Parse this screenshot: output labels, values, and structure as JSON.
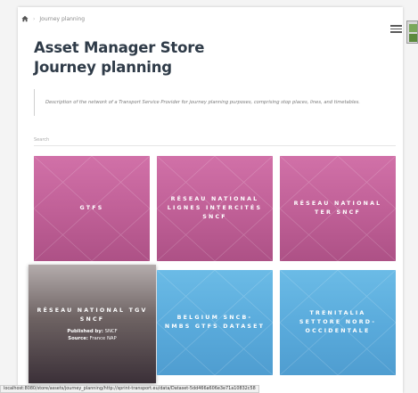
{
  "breadcrumb": {
    "current": "Journey planning",
    "separator": "›"
  },
  "header": {
    "title_line1": "Asset Manager Store",
    "title_line2": "Journey planning"
  },
  "description": "Description of the network of a Transport Service Provider for journey planning purposes, comprising stop places, lines, and timetables.",
  "search": {
    "placeholder": "Search",
    "value": ""
  },
  "tiles": [
    {
      "label": "GTFS",
      "color": "pink"
    },
    {
      "label": "RÉSEAU NATIONAL LIGNES INTERCITÉS SNCF",
      "color": "pink"
    },
    {
      "label": "RÉSEAU NATIONAL TER SNCF",
      "color": "pink"
    },
    {
      "label": "RÉSEAU NATIONAL TGV SNCF",
      "color": "dark",
      "published_by_label": "Published by:",
      "published_by": "SNCF",
      "source_label": "Source:",
      "source": "France NAP"
    },
    {
      "label": "BELGIUM SNCB-NMBS GTFS DATASET",
      "color": "blue"
    },
    {
      "label": "TRENITALIA SETTORE NORD-OCCIDENTALE",
      "color": "blue"
    }
  ],
  "statusbar": "localhost:8080/store/assets/journey_planning/http://sprint-transport.eu/data/Dataset-5dd466a606e3e71a10832c58",
  "colors": {
    "pink": "#c3659c",
    "blue": "#5aaadb",
    "title": "#2f3b48"
  },
  "icons": {
    "home": "home-icon",
    "menu": "hamburger-menu-icon"
  }
}
